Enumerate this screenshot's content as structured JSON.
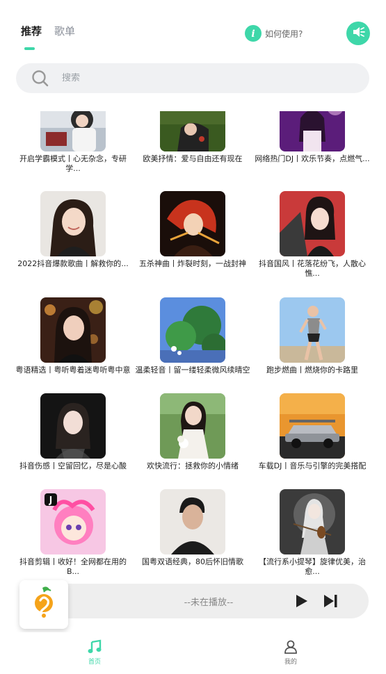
{
  "header": {
    "tabs": [
      {
        "label": "推荐",
        "active": true
      },
      {
        "label": "歌单",
        "active": false
      }
    ],
    "howto_label": "如何使用?",
    "accent_color": "#3ed7a9"
  },
  "search": {
    "placeholder": "搜索",
    "value": ""
  },
  "playlists": [
    {
      "title": "开启学霸模式丨心无杂念，专研学...",
      "icon": "cover-study-girl"
    },
    {
      "title": "欧美抒情：爱与自由还有现在",
      "icon": "cover-woman-grass"
    },
    {
      "title": "网络热门DJ丨欢乐节奏，点燃气...",
      "icon": "cover-pink-lights"
    },
    {
      "title": "2022抖音爆款歌曲丨解救你的...",
      "icon": "cover-smiling-girl"
    },
    {
      "title": "五杀神曲丨炸裂时刻，一战封神",
      "icon": "cover-anime-warrior"
    },
    {
      "title": "抖音国风丨花落花纷飞，人散心憔...",
      "icon": "cover-fan-girl"
    },
    {
      "title": "粤语精选丨粤听粤着迷粤听粤中意",
      "icon": "cover-woman-bokeh"
    },
    {
      "title": "温柔轻音丨留一缕轻柔微风续晴空",
      "icon": "cover-anime-garden"
    },
    {
      "title": "跑步燃曲丨燃烧你的卡路里",
      "icon": "cover-runner"
    },
    {
      "title": "抖音伤感丨空留回忆，尽是心酸",
      "icon": "cover-dark-girl"
    },
    {
      "title": "欢快流行：拯救你的小情绪",
      "icon": "cover-bride-flowers"
    },
    {
      "title": "车载DJ丨音乐与引擎的完美搭配",
      "icon": "cover-sports-car"
    },
    {
      "title": "抖音剪辑丨收好！全网都在用的B...",
      "icon": "cover-tiktok-anime"
    },
    {
      "title": "国粤双语经典，80后怀旧情歌",
      "icon": "cover-man-portrait"
    },
    {
      "title": "【流行系小提琴】旋律优美，治愈...",
      "icon": "cover-violinist"
    }
  ],
  "player": {
    "status": "--未在播放--"
  },
  "bottom_nav": [
    {
      "label": "首页",
      "icon": "music-note-icon",
      "active": true
    },
    {
      "label": "我的",
      "icon": "user-icon",
      "active": false
    }
  ]
}
